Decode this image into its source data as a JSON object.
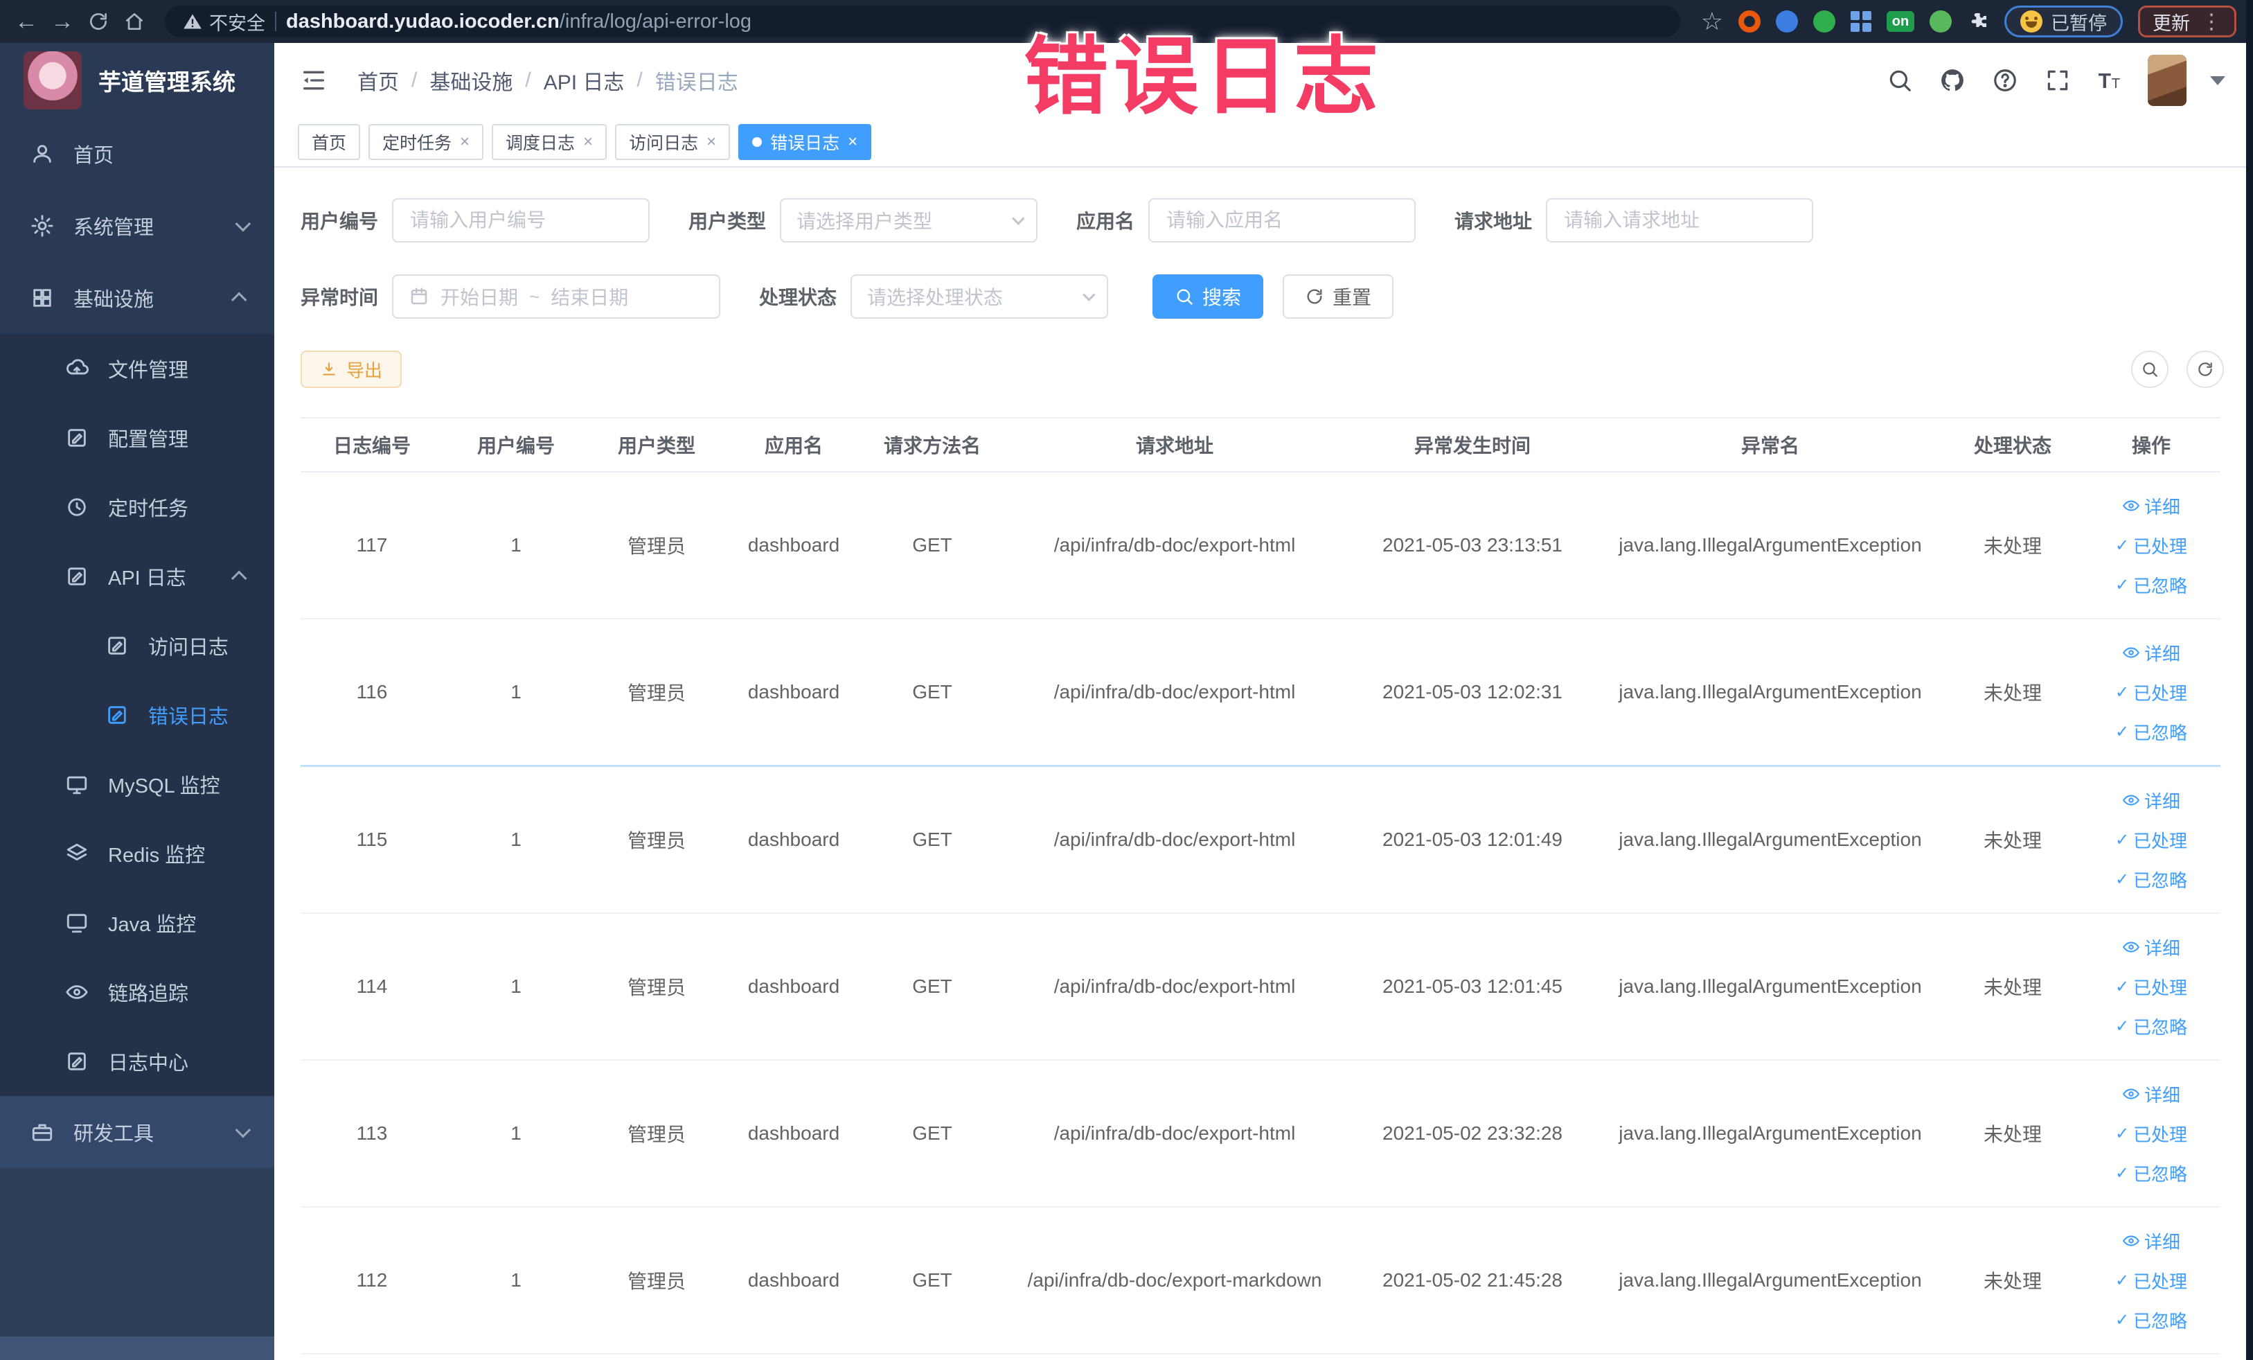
{
  "browser": {
    "security_label": "不安全",
    "url_host": "dashboard.yudao.iocoder.cn",
    "url_path": "/infra/log/api-error-log",
    "paused_label": "已暂停",
    "update_label": "更新",
    "extensions": [
      {
        "name": "ext-orange-ring-icon",
        "color": "#e8590c",
        "kind": "ring"
      },
      {
        "name": "ext-blue-shield-icon",
        "color": "#3b7de0",
        "kind": "dot"
      },
      {
        "name": "ext-green-circle-icon",
        "color": "#2fae4e",
        "kind": "dot"
      },
      {
        "name": "ext-grid-icon",
        "color": "#6fa3e8",
        "kind": "grid"
      },
      {
        "name": "ext-on-badge-icon",
        "color": "#1f9d4d",
        "kind": "badge",
        "badge": "on"
      },
      {
        "name": "ext-leaf-icon",
        "color": "#57b85c",
        "kind": "dot"
      },
      {
        "name": "ext-puzzle-icon",
        "color": "#dfe3ea",
        "kind": "puzzle"
      }
    ]
  },
  "sidebar": {
    "title": "芋道管理系统",
    "items": [
      {
        "id": "home",
        "label": "首页",
        "icon": "person-icon",
        "level": 1
      },
      {
        "id": "system-mgmt",
        "label": "系统管理",
        "icon": "gear-icon",
        "level": 1,
        "arrow": "down"
      },
      {
        "id": "infrastructure",
        "label": "基础设施",
        "icon": "grid-icon",
        "level": 1,
        "arrow": "up"
      },
      {
        "id": "file-mgmt",
        "label": "文件管理",
        "icon": "cloud-upload-icon",
        "level": 2,
        "sub": true
      },
      {
        "id": "config-mgmt",
        "label": "配置管理",
        "icon": "edit-icon",
        "level": 2,
        "sub": true
      },
      {
        "id": "scheduled-jobs",
        "label": "定时任务",
        "icon": "clock-icon",
        "level": 2,
        "sub": true
      },
      {
        "id": "api-log",
        "label": "API 日志",
        "icon": "edit-icon",
        "level": 2,
        "arrow": "up",
        "sub": true
      },
      {
        "id": "access-log",
        "label": "访问日志",
        "icon": "edit-icon",
        "level": 3,
        "sub": true
      },
      {
        "id": "error-log",
        "label": "错误日志",
        "icon": "edit-icon",
        "level": 3,
        "active": true,
        "sub": true
      },
      {
        "id": "mysql-monitor",
        "label": "MySQL 监控",
        "icon": "monitor-icon",
        "level": 2,
        "sub": true
      },
      {
        "id": "redis-monitor",
        "label": "Redis 监控",
        "icon": "layers-icon",
        "level": 2,
        "sub": true
      },
      {
        "id": "java-monitor",
        "label": "Java 监控",
        "icon": "screen-icon",
        "level": 2,
        "sub": true
      },
      {
        "id": "trace",
        "label": "链路追踪",
        "icon": "eye-icon",
        "level": 2,
        "sub": true
      },
      {
        "id": "log-center",
        "label": "日志中心",
        "icon": "edit-icon",
        "level": 2,
        "sub": true
      },
      {
        "id": "dev-tools",
        "label": "研发工具",
        "icon": "briefcase-icon",
        "level": 1,
        "arrow": "down",
        "dev": true
      }
    ]
  },
  "header": {
    "breadcrumb": [
      "首页",
      "基础设施",
      "API 日志",
      "错误日志"
    ]
  },
  "tabs": [
    {
      "id": "home",
      "label": "首页",
      "closable": false,
      "active": false
    },
    {
      "id": "scheduled-jobs",
      "label": "定时任务",
      "closable": true,
      "active": false
    },
    {
      "id": "schedule-log",
      "label": "调度日志",
      "closable": true,
      "active": false
    },
    {
      "id": "access-log",
      "label": "访问日志",
      "closable": true,
      "active": false
    },
    {
      "id": "error-log",
      "label": "错误日志",
      "closable": true,
      "active": true
    }
  ],
  "filters": {
    "user_id": {
      "label": "用户编号",
      "placeholder": "请输入用户编号"
    },
    "user_type": {
      "label": "用户类型",
      "placeholder": "请选择用户类型"
    },
    "app_name": {
      "label": "应用名",
      "placeholder": "请输入应用名"
    },
    "request_url": {
      "label": "请求地址",
      "placeholder": "请输入请求地址"
    },
    "exception_time": {
      "label": "异常时间",
      "start_placeholder": "开始日期",
      "separator": "~",
      "end_placeholder": "结束日期"
    },
    "process_status": {
      "label": "处理状态",
      "placeholder": "请选择处理状态"
    },
    "search_label": "搜索",
    "reset_label": "重置"
  },
  "toolbar": {
    "export_label": "导出"
  },
  "table": {
    "columns": [
      "日志编号",
      "用户编号",
      "用户类型",
      "应用名",
      "请求方法名",
      "请求地址",
      "异常发生时间",
      "异常名",
      "处理状态",
      "操作"
    ],
    "row_actions": [
      {
        "label": "详细",
        "icon": "eye-icon"
      },
      {
        "label": "已处理",
        "icon": "check-icon"
      },
      {
        "label": "已忽略",
        "icon": "check-icon"
      }
    ],
    "rows": [
      {
        "log_id": "117",
        "user_id": "1",
        "user_type": "管理员",
        "app": "dashboard",
        "method": "GET",
        "url": "/api/infra/db-doc/export-html",
        "time": "2021-05-03 23:13:51",
        "exception": "java.lang.IllegalArgumentException",
        "status": "未处理"
      },
      {
        "log_id": "116",
        "user_id": "1",
        "user_type": "管理员",
        "app": "dashboard",
        "method": "GET",
        "url": "/api/infra/db-doc/export-html",
        "time": "2021-05-03 12:02:31",
        "exception": "java.lang.IllegalArgumentException",
        "status": "未处理"
      },
      {
        "log_id": "115",
        "user_id": "1",
        "user_type": "管理员",
        "app": "dashboard",
        "method": "GET",
        "url": "/api/infra/db-doc/export-html",
        "time": "2021-05-03 12:01:49",
        "exception": "java.lang.IllegalArgumentException",
        "status": "未处理"
      },
      {
        "log_id": "114",
        "user_id": "1",
        "user_type": "管理员",
        "app": "dashboard",
        "method": "GET",
        "url": "/api/infra/db-doc/export-html",
        "time": "2021-05-03 12:01:45",
        "exception": "java.lang.IllegalArgumentException",
        "status": "未处理"
      },
      {
        "log_id": "113",
        "user_id": "1",
        "user_type": "管理员",
        "app": "dashboard",
        "method": "GET",
        "url": "/api/infra/db-doc/export-html",
        "time": "2021-05-02 23:32:28",
        "exception": "java.lang.IllegalArgumentException",
        "status": "未处理"
      },
      {
        "log_id": "112",
        "user_id": "1",
        "user_type": "管理员",
        "app": "dashboard",
        "method": "GET",
        "url": "/api/infra/db-doc/export-markdown",
        "time": "2021-05-02 21:45:28",
        "exception": "java.lang.IllegalArgumentException",
        "status": "未处理"
      }
    ]
  },
  "watermark": {
    "text": "错误日志",
    "color": "#f43b63"
  },
  "colors": {
    "accent": "#409EFF",
    "warning": "#e6a23c",
    "sidebar_bg": "#2b3a54",
    "chrome_bg": "#1d2636"
  }
}
